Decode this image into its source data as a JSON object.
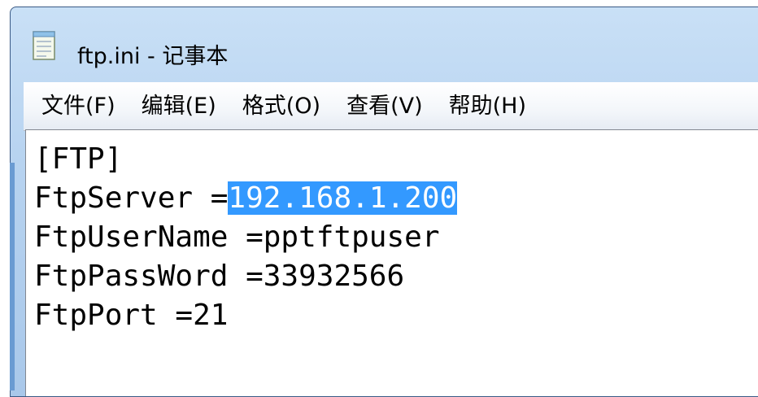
{
  "window": {
    "title": "ftp.ini - 记事本",
    "accent": "#b7d3f0"
  },
  "menubar": {
    "items": [
      {
        "label": "文件",
        "key": "(F)"
      },
      {
        "label": "编辑",
        "key": "(E)"
      },
      {
        "label": "格式",
        "key": "(O)"
      },
      {
        "label": "查看",
        "key": "(V)"
      },
      {
        "label": "帮助",
        "key": "(H)"
      }
    ]
  },
  "editor": {
    "lines": [
      {
        "text": "[FTP]"
      },
      {
        "prefix": "FtpServer =",
        "selected": "192.168.1.200"
      },
      {
        "text": "FtpUserName =pptftpuser"
      },
      {
        "text": "FtpPassWord =33932566"
      },
      {
        "text": "FtpPort =21"
      }
    ],
    "selection_color": "#3399ff"
  },
  "icons": {
    "app_icon": "notepad-icon"
  }
}
